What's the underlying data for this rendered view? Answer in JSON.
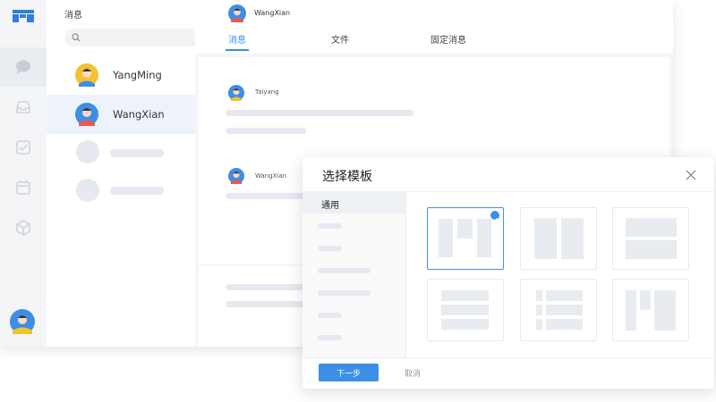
{
  "sidebar": {
    "title": "消息",
    "search_placeholder": ""
  },
  "contacts": [
    {
      "name": "YangMing"
    },
    {
      "name": "WangXian"
    }
  ],
  "chat": {
    "user": "WangXian",
    "tabs": [
      {
        "label": "消息"
      },
      {
        "label": "文件"
      },
      {
        "label": "固定消息"
      }
    ],
    "messages": [
      {
        "user": "Taiyang"
      },
      {
        "user": "WangXian"
      }
    ]
  },
  "modal": {
    "title": "选择模板",
    "category": "通用",
    "next_label": "下一步",
    "cancel_label": "取消"
  },
  "icons": [
    "logo-icon",
    "chat-icon",
    "inbox-icon",
    "checkbox-icon",
    "calendar-icon",
    "cube-icon",
    "search-icon",
    "close-icon",
    "check-icon"
  ],
  "colors": {
    "accent": "#3d8ee6",
    "placeholder": "#e6e9ef"
  }
}
